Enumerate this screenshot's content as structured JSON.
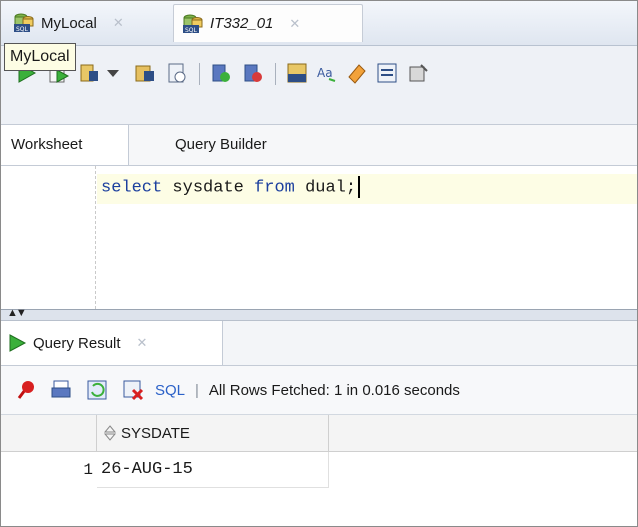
{
  "tabs": [
    {
      "label": "MyLocal",
      "active": false
    },
    {
      "label": "IT332_01",
      "active": true
    }
  ],
  "tooltip": "MyLocal",
  "toolbar_icons": [
    "run-statement-icon",
    "run-script-icon",
    "dropdown-icon",
    "commit-icon",
    "rollback-icon",
    "autotrace-icon",
    "explain-plan-icon",
    "sql-tuning-icon",
    "format-icon",
    "clear-icon",
    "history-icon",
    "unshared-sql-icon"
  ],
  "subtabs": {
    "worksheet": "Worksheet",
    "query_builder": "Query Builder"
  },
  "editor": {
    "kw1": "select",
    "word1": "sysdate",
    "kw2": "from",
    "word2": "dual;"
  },
  "result": {
    "tab_label": "Query Result",
    "sql_label": "SQL",
    "separator": "|",
    "status": "All Rows Fetched: 1 in 0.016 seconds",
    "columns": [
      "SYSDATE"
    ],
    "rows": [
      {
        "num": "1",
        "values": [
          "26-AUG-15"
        ]
      }
    ]
  },
  "colors": {
    "accent": "#2b61c8",
    "editor_line_highlight": "#fdfde5",
    "keyword": "#1c3f9e"
  }
}
